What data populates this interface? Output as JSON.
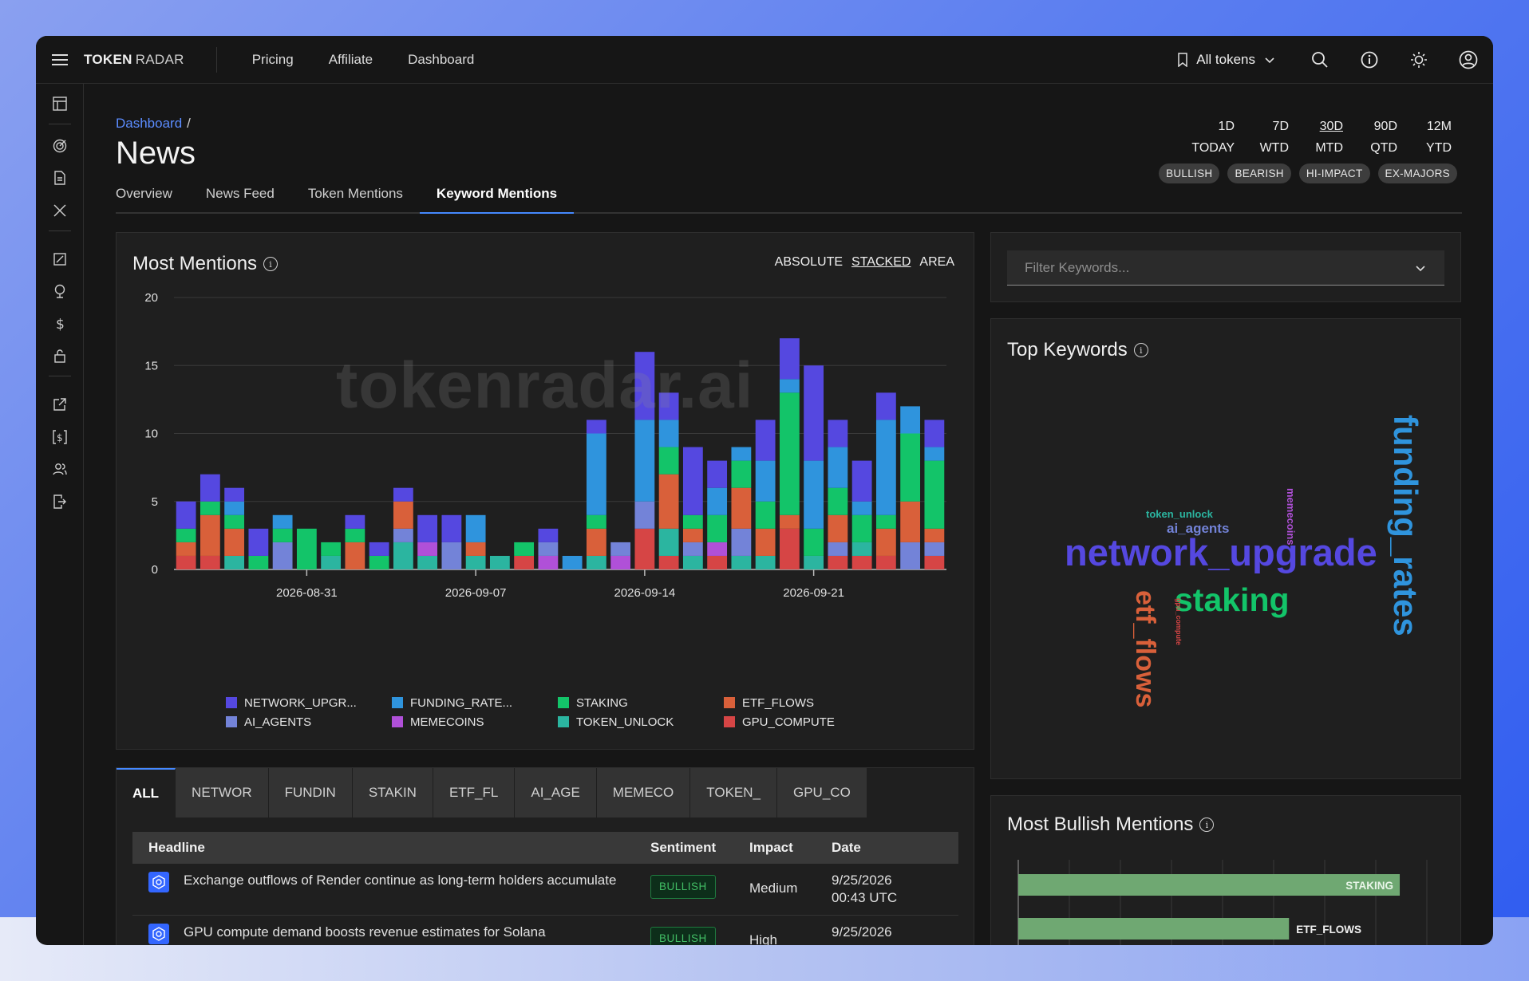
{
  "brand": {
    "bold": "TOKEN",
    "light": "RADAR"
  },
  "nav": {
    "links": [
      "Pricing",
      "Affiliate",
      "Dashboard"
    ],
    "token_select": "All tokens"
  },
  "breadcrumb": {
    "link": "Dashboard",
    "sep": "/"
  },
  "page_title": "News",
  "tabs": [
    "Overview",
    "News Feed",
    "Token Mentions",
    "Keyword Mentions"
  ],
  "active_tab": "Keyword Mentions",
  "periods": [
    {
      "top": "1D",
      "bottom": "TODAY"
    },
    {
      "top": "7D",
      "bottom": "WTD"
    },
    {
      "top": "30D",
      "bottom": "MTD"
    },
    {
      "top": "90D",
      "bottom": "QTD"
    },
    {
      "top": "12M",
      "bottom": "YTD"
    }
  ],
  "selected_period": "30D",
  "filters": [
    "BULLISH",
    "BEARISH",
    "HI-IMPACT",
    "EX-MAJORS"
  ],
  "most_mentions": {
    "title": "Most Mentions",
    "modes": [
      "ABSOLUTE",
      "STACKED",
      "AREA"
    ],
    "selected_mode": "STACKED",
    "watermark": "tokenradar.ai"
  },
  "chart_data": {
    "type": "bar",
    "stacked": true,
    "title": "Most Mentions",
    "ylim": [
      0,
      20
    ],
    "yticks": [
      0,
      5,
      10,
      15,
      20
    ],
    "xticks": [
      "2026-08-31",
      "2026-09-07",
      "2026-09-14",
      "2026-09-21"
    ],
    "xtick_index": [
      5,
      12,
      19,
      26
    ],
    "grid": true,
    "legend_position": "bottom",
    "categories_count": 32,
    "series": [
      {
        "name": "GPU_COMPUTE",
        "color": "#d64545",
        "values": [
          1,
          1,
          0,
          0,
          0,
          0,
          0,
          0,
          0,
          0,
          0,
          0,
          0,
          0,
          1,
          0,
          0,
          0,
          0,
          3,
          1,
          0,
          1,
          0,
          0,
          3,
          0,
          1,
          1,
          1,
          0,
          1
        ]
      },
      {
        "name": "TOKEN_UNLOCK",
        "color": "#2bb5a0",
        "values": [
          0,
          0,
          1,
          0,
          0,
          0,
          1,
          0,
          0,
          2,
          1,
          0,
          1,
          1,
          0,
          0,
          0,
          1,
          0,
          0,
          2,
          1,
          0,
          1,
          1,
          0,
          1,
          0,
          1,
          0,
          0,
          0
        ]
      },
      {
        "name": "MEMECOINS",
        "color": "#b050d8",
        "values": [
          0,
          0,
          0,
          0,
          0,
          0,
          0,
          0,
          0,
          0,
          1,
          0,
          0,
          0,
          0,
          1,
          0,
          0,
          1,
          0,
          0,
          0,
          1,
          0,
          0,
          0,
          0,
          0,
          0,
          0,
          0,
          0
        ]
      },
      {
        "name": "AI_AGENTS",
        "color": "#7383d8",
        "values": [
          0,
          0,
          0,
          0,
          2,
          0,
          0,
          0,
          0,
          1,
          0,
          2,
          0,
          0,
          0,
          1,
          0,
          0,
          1,
          2,
          0,
          1,
          0,
          2,
          0,
          0,
          0,
          1,
          0,
          0,
          2,
          1
        ]
      },
      {
        "name": "ETF_FLOWS",
        "color": "#d9603a",
        "values": [
          1,
          3,
          2,
          0,
          0,
          0,
          0,
          2,
          0,
          2,
          0,
          0,
          1,
          0,
          0,
          0,
          0,
          2,
          0,
          0,
          4,
          1,
          0,
          3,
          2,
          1,
          0,
          2,
          0,
          2,
          3,
          1
        ]
      },
      {
        "name": "STAKING",
        "color": "#13c469",
        "values": [
          1,
          1,
          1,
          1,
          1,
          3,
          1,
          1,
          1,
          0,
          0,
          0,
          0,
          0,
          1,
          0,
          0,
          1,
          0,
          0,
          2,
          1,
          2,
          2,
          2,
          9,
          2,
          2,
          2,
          1,
          5,
          5
        ]
      },
      {
        "name": "FUNDING_RATES",
        "color": "#2f94dd",
        "values": [
          0,
          0,
          1,
          0,
          1,
          0,
          0,
          0,
          0,
          0,
          0,
          0,
          2,
          0,
          0,
          0,
          1,
          6,
          0,
          6,
          2,
          0,
          2,
          1,
          3,
          1,
          5,
          3,
          1,
          7,
          2,
          1
        ]
      },
      {
        "name": "NETWORK_UPGRADE",
        "color": "#5548e0",
        "values": [
          2,
          2,
          1,
          2,
          0,
          0,
          0,
          1,
          1,
          1,
          2,
          2,
          0,
          0,
          0,
          1,
          0,
          1,
          0,
          5,
          2,
          5,
          2,
          0,
          3,
          3,
          7,
          2,
          3,
          2,
          0,
          2
        ]
      }
    ],
    "legend": [
      "NETWORK_UPGR...",
      "FUNDING_RATE...",
      "STAKING",
      "ETF_FLOWS",
      "AI_AGENTS",
      "MEMECOINS",
      "TOKEN_UNLOCK",
      "GPU_COMPUTE"
    ],
    "legend_colors": [
      "#5548e0",
      "#2f94dd",
      "#13c469",
      "#d9603a",
      "#7383d8",
      "#b050d8",
      "#2bb5a0",
      "#d64545"
    ]
  },
  "filter_keywords": {
    "placeholder": "Filter Keywords..."
  },
  "top_keywords": {
    "title": "Top Keywords",
    "words": [
      {
        "text": "network_upgrade",
        "color": "#5548e0"
      },
      {
        "text": "funding_rates",
        "color": "#2f94dd"
      },
      {
        "text": "staking",
        "color": "#13c469"
      },
      {
        "text": "etf_flows",
        "color": "#d9603a"
      },
      {
        "text": "ai_agents",
        "color": "#7383d8"
      },
      {
        "text": "token_unlock",
        "color": "#2bb5a0"
      },
      {
        "text": "memecoins",
        "color": "#b050d8"
      },
      {
        "text": "gpu_compute",
        "color": "#d64545"
      }
    ]
  },
  "keyword_tabs": [
    "ALL",
    "NETWOR",
    "FUNDIN",
    "STAKIN",
    "ETF_FL",
    "AI_AGE",
    "MEMECO",
    "TOKEN_",
    "GPU_CO"
  ],
  "table": {
    "headers": [
      "Headline",
      "Sentiment",
      "Impact",
      "Date"
    ],
    "rows": [
      {
        "headline": "Exchange outflows of Render continue as long-term holders accumulate",
        "sentiment": "BULLISH",
        "impact": "Medium",
        "date": "9/25/2026",
        "time": "00:43 UTC"
      },
      {
        "headline": "GPU compute demand boosts revenue estimates for Solana",
        "sentiment": "BULLISH",
        "impact": "High",
        "date": "9/25/2026",
        "time": ""
      }
    ]
  },
  "bullish": {
    "title": "Most Bullish Mentions",
    "bars": [
      {
        "label": "STAKING",
        "value": 0.93
      },
      {
        "label": "ETF_FLOWS",
        "value": 0.66
      }
    ],
    "bar_color": "#6fa872"
  }
}
